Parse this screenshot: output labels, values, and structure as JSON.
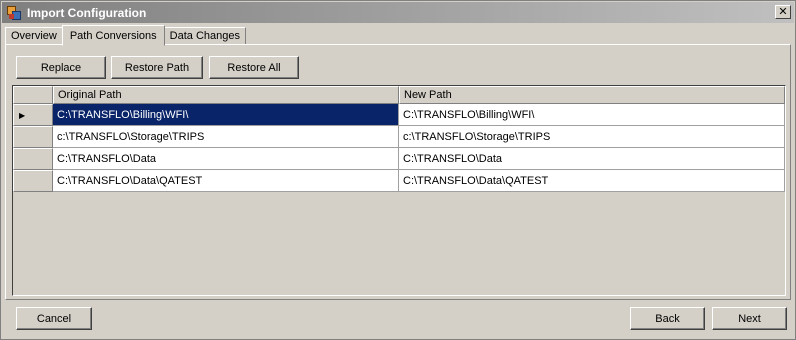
{
  "window": {
    "title": "Import Configuration",
    "close_glyph": "✕"
  },
  "tabs": [
    {
      "label": "Overview",
      "active": false
    },
    {
      "label": "Path Conversions",
      "active": true
    },
    {
      "label": "Data Changes",
      "active": false
    }
  ],
  "toolbar": {
    "replace_label": "Replace",
    "restore_path_label": "Restore Path",
    "restore_all_label": "Restore All"
  },
  "grid": {
    "columns": [
      "Original Path",
      "New Path"
    ],
    "current_row_glyph": "▶",
    "rows": [
      {
        "original": "C:\\TRANSFLO\\Billing\\WFI\\",
        "new": "C:\\TRANSFLO\\Billing\\WFI\\",
        "selected": true
      },
      {
        "original": "c:\\TRANSFLO\\Storage\\TRIPS",
        "new": "c:\\TRANSFLO\\Storage\\TRIPS",
        "selected": false
      },
      {
        "original": "C:\\TRANSFLO\\Data",
        "new": "C:\\TRANSFLO\\Data",
        "selected": false
      },
      {
        "original": "C:\\TRANSFLO\\Data\\QATEST",
        "new": "C:\\TRANSFLO\\Data\\QATEST",
        "selected": false
      }
    ]
  },
  "footer": {
    "cancel_label": "Cancel",
    "back_label": "Back",
    "next_label": "Next"
  },
  "colors": {
    "selection": "#0a246a",
    "face": "#d4d0c8"
  }
}
